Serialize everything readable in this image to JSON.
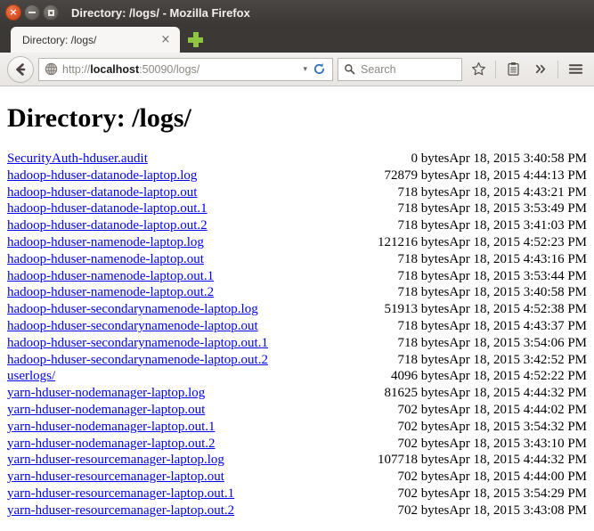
{
  "window": {
    "title": "Directory: /logs/ - Mozilla Firefox",
    "close_label": "×",
    "minimize_label": "",
    "maximize_label": ""
  },
  "tabs": {
    "active": {
      "label": "Directory: /logs/",
      "close_label": "×"
    },
    "new_tab_label": "+"
  },
  "toolbar": {
    "back_label": "←",
    "url_scheme": "http://",
    "url_host": "localhost",
    "url_rest": ":50090/logs/",
    "url_full": "http://localhost:50090/logs/",
    "dropdown_label": "▾",
    "reload_label": "↻",
    "search_placeholder": "Search",
    "bookmark_label": "☆",
    "reading_list_label": "὜b",
    "overflow_label": "»",
    "menu_label": "≡"
  },
  "page": {
    "heading": "Directory: /logs/",
    "rows": [
      {
        "name": "SecurityAuth-hduser.audit ",
        "size": "0 bytes",
        "date": "Apr 18, 2015 3:40:58 PM"
      },
      {
        "name": "hadoop-hduser-datanode-laptop.log ",
        "size": "72879 bytes",
        "date": "Apr 18, 2015 4:44:13 PM"
      },
      {
        "name": "hadoop-hduser-datanode-laptop.out ",
        "size": "718 bytes",
        "date": "Apr 18, 2015 4:43:21 PM"
      },
      {
        "name": "hadoop-hduser-datanode-laptop.out.1 ",
        "size": "718 bytes",
        "date": "Apr 18, 2015 3:53:49 PM"
      },
      {
        "name": "hadoop-hduser-datanode-laptop.out.2 ",
        "size": "718 bytes",
        "date": "Apr 18, 2015 3:41:03 PM"
      },
      {
        "name": "hadoop-hduser-namenode-laptop.log ",
        "size": "121216 bytes",
        "date": "Apr 18, 2015 4:52:23 PM"
      },
      {
        "name": "hadoop-hduser-namenode-laptop.out ",
        "size": "718 bytes",
        "date": "Apr 18, 2015 4:43:16 PM"
      },
      {
        "name": "hadoop-hduser-namenode-laptop.out.1 ",
        "size": "718 bytes",
        "date": "Apr 18, 2015 3:53:44 PM"
      },
      {
        "name": "hadoop-hduser-namenode-laptop.out.2 ",
        "size": "718 bytes",
        "date": "Apr 18, 2015 3:40:58 PM"
      },
      {
        "name": "hadoop-hduser-secondarynamenode-laptop.log ",
        "size": "51913 bytes",
        "date": "Apr 18, 2015 4:52:38 PM"
      },
      {
        "name": "hadoop-hduser-secondarynamenode-laptop.out ",
        "size": "718 bytes",
        "date": "Apr 18, 2015 4:43:37 PM"
      },
      {
        "name": "hadoop-hduser-secondarynamenode-laptop.out.1 ",
        "size": "718 bytes",
        "date": "Apr 18, 2015 3:54:06 PM"
      },
      {
        "name": "hadoop-hduser-secondarynamenode-laptop.out.2 ",
        "size": "718 bytes",
        "date": "Apr 18, 2015 3:42:52 PM"
      },
      {
        "name": "userlogs/ ",
        "size": "4096 bytes",
        "date": "Apr 18, 2015 4:52:22 PM"
      },
      {
        "name": "yarn-hduser-nodemanager-laptop.log ",
        "size": "81625 bytes",
        "date": "Apr 18, 2015 4:44:32 PM"
      },
      {
        "name": "yarn-hduser-nodemanager-laptop.out ",
        "size": "702 bytes",
        "date": "Apr 18, 2015 4:44:02 PM"
      },
      {
        "name": "yarn-hduser-nodemanager-laptop.out.1 ",
        "size": "702 bytes",
        "date": "Apr 18, 2015 3:54:32 PM"
      },
      {
        "name": "yarn-hduser-nodemanager-laptop.out.2 ",
        "size": "702 bytes",
        "date": "Apr 18, 2015 3:43:10 PM"
      },
      {
        "name": "yarn-hduser-resourcemanager-laptop.log ",
        "size": "107718 bytes",
        "date": "Apr 18, 2015 4:44:32 PM"
      },
      {
        "name": "yarn-hduser-resourcemanager-laptop.out ",
        "size": "702 bytes",
        "date": "Apr 18, 2015 4:44:00 PM"
      },
      {
        "name": "yarn-hduser-resourcemanager-laptop.out.1 ",
        "size": "702 bytes",
        "date": "Apr 18, 2015 3:54:29 PM"
      },
      {
        "name": "yarn-hduser-resourcemanager-laptop.out.2 ",
        "size": "702 bytes",
        "date": "Apr 18, 2015 3:43:08 PM"
      }
    ]
  },
  "colors": {
    "link": "#0000ee",
    "titlebar": "#3c3836",
    "new_tab_plus": "#8ec63f",
    "close_button": "#d9542a"
  }
}
